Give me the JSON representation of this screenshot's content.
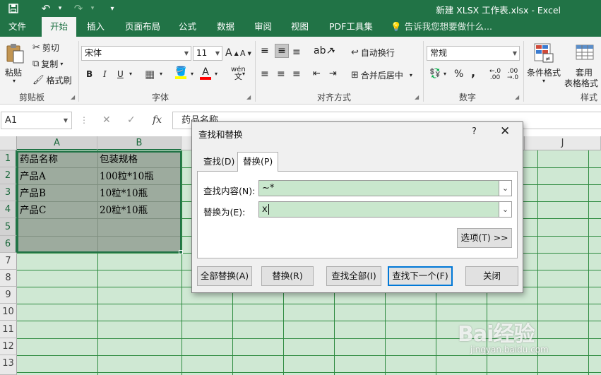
{
  "window": {
    "title": "新建 XLSX 工作表.xlsx - Excel",
    "brand_color": "#217346"
  },
  "quick_access": {
    "save_icon": "save-icon",
    "undo_icon": "undo-icon",
    "redo_icon": "redo-icon",
    "customize_icon": "customize-icon"
  },
  "ribbon_tabs": [
    "文件",
    "开始",
    "插入",
    "页面布局",
    "公式",
    "数据",
    "审阅",
    "视图",
    "PDF工具集"
  ],
  "active_tab": "开始",
  "tell_me": "告诉我您想要做什么...",
  "ribbon": {
    "clipboard": {
      "label": "剪贴板",
      "paste": "粘贴",
      "cut": "剪切",
      "copy": "复制",
      "format_painter": "格式刷"
    },
    "font": {
      "label": "字体",
      "font_name": "宋体",
      "font_size": "11",
      "bold": "B",
      "italic": "I",
      "underline": "U",
      "phonetic": "wén",
      "fill_color": "#ffff00",
      "font_color": "#ff0000"
    },
    "alignment": {
      "label": "对齐方式",
      "wrap_text": "自动换行",
      "merge_center": "合并后居中"
    },
    "number": {
      "label": "数字",
      "format": "常规",
      "percent": "%",
      "comma": ","
    },
    "styles": {
      "label": "样式",
      "conditional": "条件格式",
      "table_format_line1": "套用",
      "table_format_line2": "表格格式"
    }
  },
  "formula_bar": {
    "name_box": "A1",
    "fx": "fx",
    "content": "药品名称"
  },
  "columns": [
    "A",
    "B",
    "J"
  ],
  "rows": [
    "1",
    "2",
    "3",
    "4",
    "5",
    "6",
    "7",
    "8",
    "9",
    "10",
    "11",
    "12",
    "13"
  ],
  "cells": {
    "a1": "药品名称",
    "b1": "包装规格",
    "a2": "产品A",
    "b2": "100粒*10瓶",
    "a3": "产品B",
    "b3": "10粒*10瓶",
    "a4": "产品C",
    "b4": "20粒*10瓶"
  },
  "dialog": {
    "title": "查找和替换",
    "help": "?",
    "tabs": [
      "查找(D)",
      "替换(P)"
    ],
    "active_tab": "替换(P)",
    "find_label": "查找内容(N):",
    "find_value": "~*",
    "replace_label": "替换为(E):",
    "replace_value": "x",
    "options_button": "选项(T) >>",
    "buttons": {
      "replace_all": "全部替换(A)",
      "replace": "替换(R)",
      "find_all": "查找全部(I)",
      "find_next": "查找下一个(F)",
      "close": "关闭"
    }
  },
  "watermark": {
    "brand": "Bai经验",
    "site": "jingyan.baidu.com"
  }
}
